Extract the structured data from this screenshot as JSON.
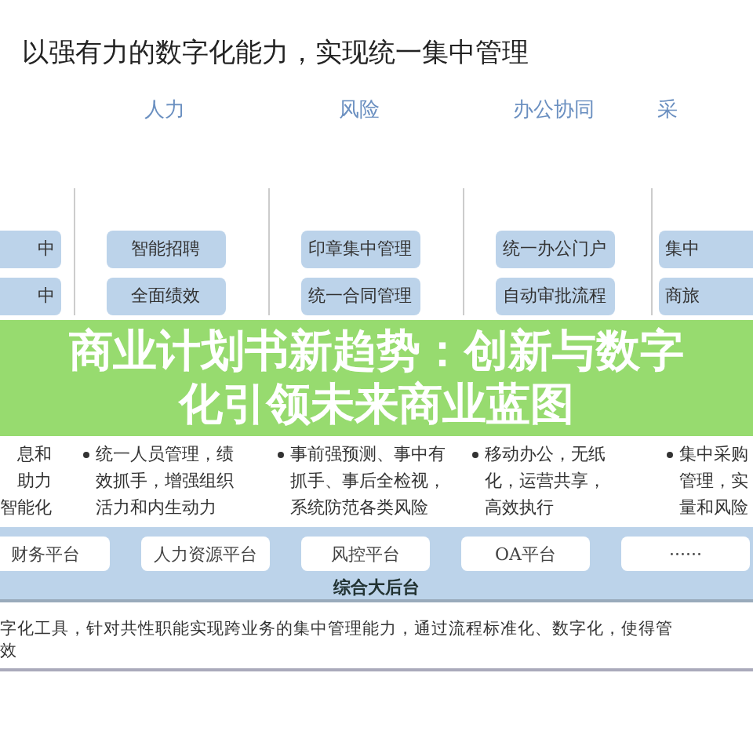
{
  "title": "以强有力的数字化能力，实现统一集中管理",
  "columns": [
    {
      "boxes": [
        "中",
        "中"
      ],
      "bullet": [
        "息和",
        "助力",
        "智能化"
      ]
    },
    {
      "heading": "人力",
      "boxes": [
        "智能招聘",
        "全面绩效"
      ],
      "bullet": [
        "统一人员管理，绩",
        "效抓手，增强组织",
        "活力和内生动力"
      ]
    },
    {
      "heading": "风险",
      "boxes": [
        "印章集中管理",
        "统一合同管理"
      ],
      "bullet": [
        "事前强预测、事中有",
        "抓手、事后全检视，",
        "系统防范各类风险"
      ]
    },
    {
      "heading": "办公协同",
      "boxes": [
        "统一办公门户",
        "自动审批流程"
      ],
      "bullet": [
        "移动办公，无纸",
        "化，运营共享，",
        "高效执行"
      ]
    },
    {
      "heading": "采",
      "boxes": [
        "集中",
        "商旅"
      ],
      "bullet": [
        "集中采购",
        "管理，实",
        "量和风险"
      ]
    }
  ],
  "platform": {
    "chips": [
      "财务平台",
      "人力资源平台",
      "风控平台",
      "OA平台",
      "······"
    ],
    "label": "综合大后台"
  },
  "description": [
    "字化工具，针对共性职能实现跨业务的集中管理能力，通过流程标准化、数字化，使得管",
    "效"
  ],
  "banner": "商业计划书新趋势：创新与数字化引领未来商业蓝图"
}
